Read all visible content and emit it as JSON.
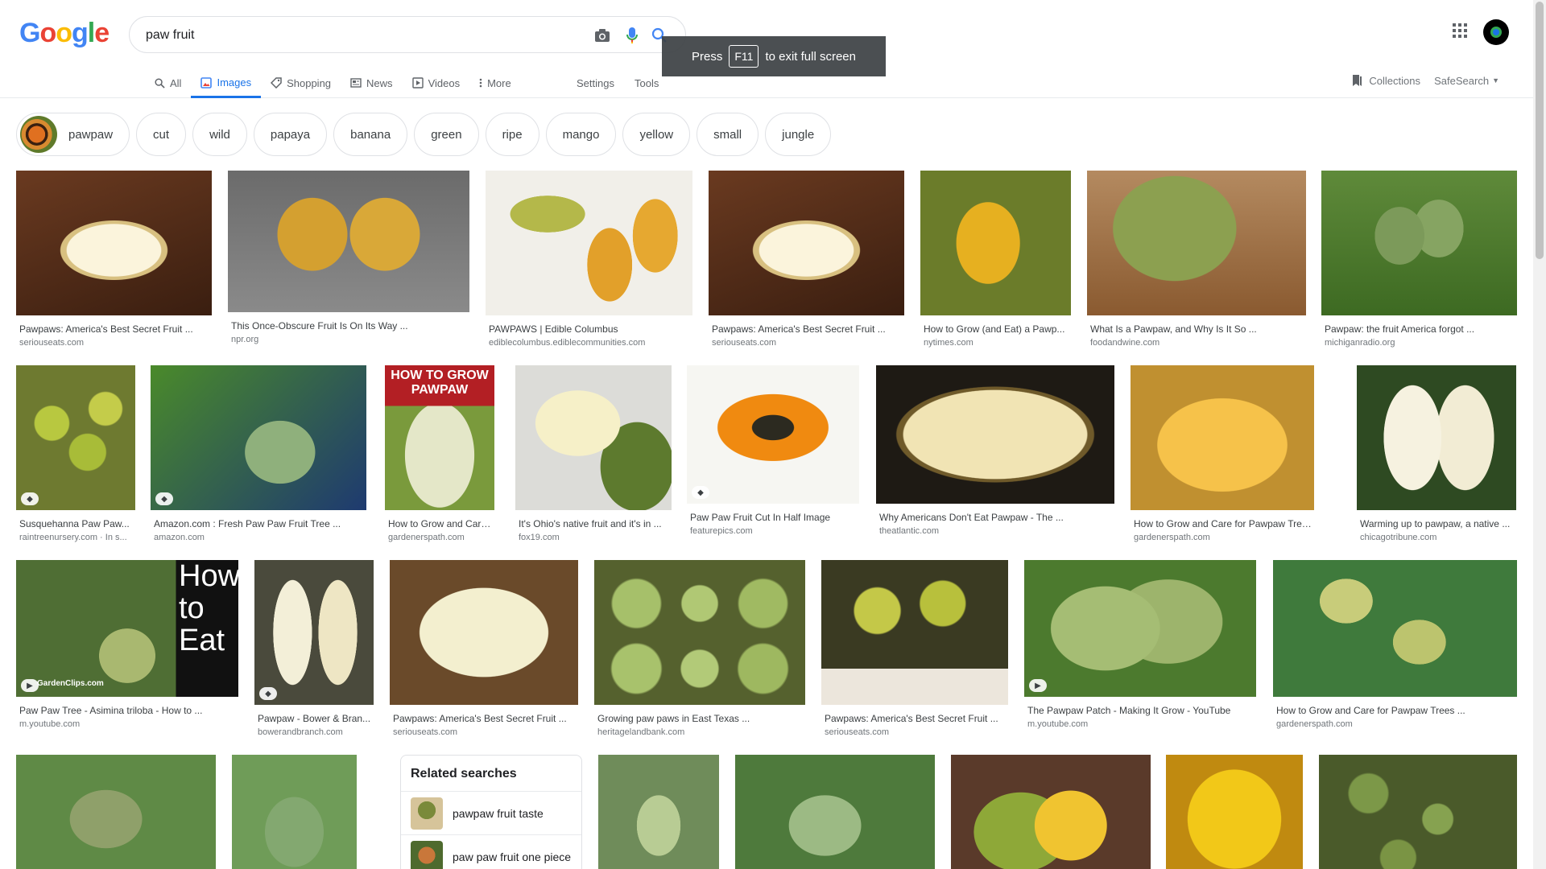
{
  "logo": {
    "letters": [
      "G",
      "o",
      "o",
      "g",
      "l",
      "e"
    ],
    "colors": [
      "#4285f4",
      "#ea4335",
      "#fbbc05",
      "#4285f4",
      "#34a853",
      "#ea4335"
    ]
  },
  "search": {
    "query": "paw fruit"
  },
  "tabs": [
    {
      "label": "All",
      "icon": "search-icon",
      "active": false
    },
    {
      "label": "Images",
      "icon": "image-icon",
      "active": true
    },
    {
      "label": "Shopping",
      "icon": "tag-icon",
      "active": false
    },
    {
      "label": "News",
      "icon": "news-icon",
      "active": false
    },
    {
      "label": "Videos",
      "icon": "video-icon",
      "active": false
    },
    {
      "label": "More",
      "icon": "more-vert-icon",
      "active": false
    }
  ],
  "tools": {
    "settings": "Settings",
    "tools": "Tools"
  },
  "right": {
    "collections": "Collections",
    "safesearch": "SafeSearch"
  },
  "fullscreen_toast": {
    "press": "Press",
    "key": "F11",
    "suffix": "to exit full screen"
  },
  "chips": [
    "pawpaw",
    "cut",
    "wild",
    "papaya",
    "banana",
    "green",
    "ripe",
    "mango",
    "yellow",
    "small",
    "jungle"
  ],
  "results": [
    {
      "title": "Pawpaws: America's Best Secret Fruit ...",
      "source": "seriouseats.com",
      "art": "t-cut",
      "badge": false
    },
    {
      "title": "This Once-Obscure Fruit Is On Its Way ...",
      "source": "npr.org",
      "art": "t-hand",
      "badge": false
    },
    {
      "title": "PAWPAWS | Edible Columbus",
      "source": "ediblecolumbus.ediblecommunities.com",
      "art": "t-yellow",
      "badge": false
    },
    {
      "title": "Pawpaws: America's Best Secret Fruit ...",
      "source": "seriouseats.com",
      "art": "t-cut",
      "badge": false
    },
    {
      "title": "How to Grow (and Eat) a Pawp...",
      "source": "nytimes.com",
      "art": "t-green-in",
      "badge": false
    },
    {
      "title": "What Is a Pawpaw, and Why Is It So ...",
      "source": "foodandwine.com",
      "art": "t-green-seed",
      "badge": false
    },
    {
      "title": "Pawpaw: the fruit America forgot ...",
      "source": "michiganradio.org",
      "art": "t-tree",
      "badge": false
    },
    {
      "title": "Susquehanna Paw Paw...",
      "source": "raintreenursery.com · In s...",
      "art": "t-pile",
      "badge": true
    },
    {
      "title": "Amazon.com : Fresh Paw Paw Fruit Tree ...",
      "source": "amazon.com",
      "art": "t-leaf",
      "badge": true
    },
    {
      "title": "How to Grow and Care ...",
      "source": "gardenerspath.com",
      "art": "t-howto",
      "badge": false
    },
    {
      "title": "It's Ohio's native fruit and it's in ...",
      "source": "fox19.com",
      "art": "t-icecream",
      "badge": false
    },
    {
      "title": "Paw Paw Fruit Cut In Half Image",
      "source": "featurepics.com",
      "art": "t-papaya",
      "badge": true
    },
    {
      "title": "Why Americans Don't Eat Pawpaw - The ...",
      "source": "theatlantic.com",
      "art": "t-dark",
      "badge": false
    },
    {
      "title": "How to Grow and Care for Pawpaw Trees ...",
      "source": "gardenerspath.com",
      "art": "t-orange",
      "badge": false
    },
    {
      "title": "Warming up to pawpaw, a native ...",
      "source": "chicagotribune.com",
      "art": "t-white",
      "badge": false
    },
    {
      "title": "Paw Paw Tree - Asimina triloba - How to ...",
      "source": "m.youtube.com",
      "art": "t-clips",
      "badge": false,
      "play": true
    },
    {
      "title": "Pawpaw - Bower & Bran...",
      "source": "bowerandbranch.com",
      "art": "t-split",
      "badge": true
    },
    {
      "title": "Pawpaws: America's Best Secret Fruit ...",
      "source": "seriouseats.com",
      "art": "t-pale",
      "badge": false
    },
    {
      "title": "Growing paw paws in East Texas ...",
      "source": "heritagelandbank.com",
      "art": "t-many",
      "badge": false
    },
    {
      "title": "Pawpaws: America's Best Secret Fruit ...",
      "source": "seriouseats.com",
      "art": "t-box",
      "badge": false
    },
    {
      "title": "The Pawpaw Patch - Making It Grow - YouTube",
      "source": "m.youtube.com",
      "art": "t-cluster",
      "badge": false,
      "play": true
    },
    {
      "title": "How to Grow and Care for Pawpaw Trees ...",
      "source": "gardenerspath.com",
      "art": "t-branch",
      "badge": false
    },
    {
      "title": "",
      "source": "",
      "art": "t-row4a",
      "badge": false
    },
    {
      "title": "",
      "source": "",
      "art": "t-row4b",
      "badge": false
    },
    {
      "title": "",
      "source": "",
      "art": "t-row4c",
      "badge": false
    },
    {
      "title": "",
      "source": "",
      "art": "t-row4d",
      "badge": false
    },
    {
      "title": "",
      "source": "",
      "art": "t-row4e",
      "badge": false
    },
    {
      "title": "",
      "source": "",
      "art": "t-row4f",
      "badge": false
    },
    {
      "title": "",
      "source": "",
      "art": "t-row4g",
      "badge": false
    }
  ],
  "thumb_overlay_text": {
    "howto": "HOW TO GROW PAWPAW",
    "clips": "How to Eat a Paw Paw",
    "clips_side": "GardenClips",
    "clips_url": "GardenClips.com"
  },
  "related": {
    "title": "Related searches",
    "items": [
      {
        "label": "pawpaw fruit taste",
        "art": "t-rel1"
      },
      {
        "label": "paw paw fruit one piece",
        "art": "t-rel2"
      }
    ]
  }
}
